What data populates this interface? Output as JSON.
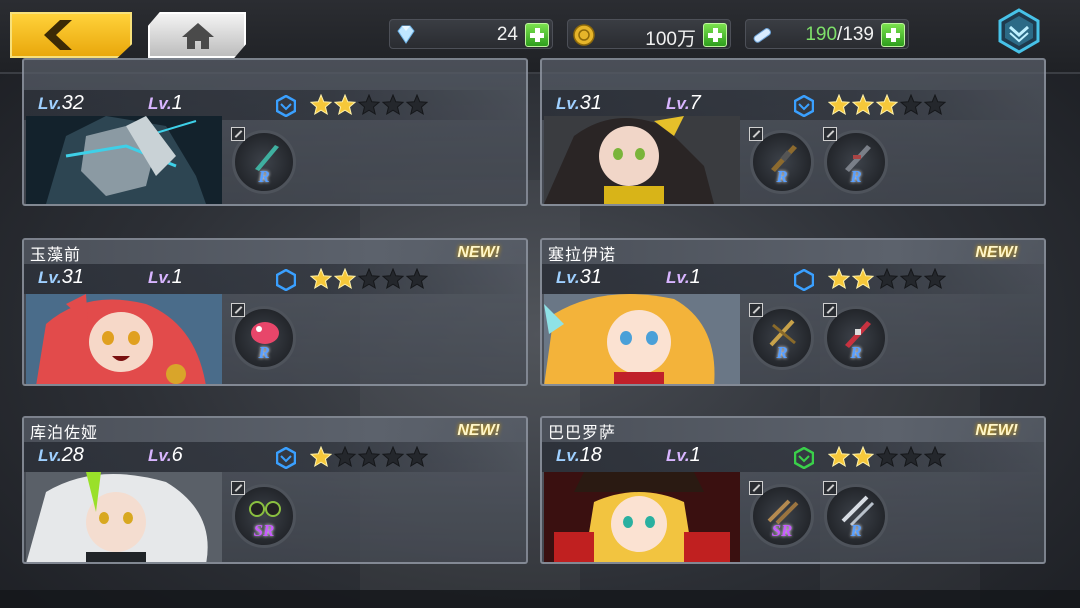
{
  "currencies": {
    "gems": {
      "value": "24",
      "icon": "diamond-icon"
    },
    "coins": {
      "value": "100万",
      "icon": "coin-icon"
    },
    "stamina": {
      "current": "190",
      "sep_max": "/139",
      "icon": "stamina-icon"
    }
  },
  "colors": {
    "accent_gold": "#f2c11e",
    "plus_green": "#3fb52a",
    "stamina_green": "#7ee06a"
  },
  "level_tags": {
    "lv1": "Lv.",
    "lv2": "Lv."
  },
  "cards": [
    {
      "name": "",
      "new": "",
      "lv": "32",
      "lv2": "1",
      "stars": 2,
      "grade": "blue-hex",
      "portrait": "dark-knight",
      "equips": [
        {
          "rank": "R",
          "weapon": "blade"
        }
      ]
    },
    {
      "name": "",
      "new": "",
      "lv": "31",
      "lv2": "7",
      "stars": 3,
      "grade": "blue-chevron",
      "portrait": "black-hair-girl",
      "equips": [
        {
          "rank": "R",
          "weapon": "rifle"
        },
        {
          "rank": "R",
          "weapon": "gun"
        }
      ]
    },
    {
      "name": "玉藻前",
      "new": "NEW!",
      "lv": "31",
      "lv2": "1",
      "stars": 2,
      "grade": "blue-hex",
      "portrait": "pink-fox-girl",
      "equips": [
        {
          "rank": "R",
          "weapon": "fish-bag"
        }
      ]
    },
    {
      "name": "塞拉伊诺",
      "new": "NEW!",
      "lv": "31",
      "lv2": "1",
      "stars": 2,
      "grade": "blue-hex",
      "portrait": "blonde-girl",
      "equips": [
        {
          "rank": "R",
          "weapon": "crossbow"
        },
        {
          "rank": "R",
          "weapon": "rifle"
        }
      ]
    },
    {
      "name": "库泊佐娅",
      "new": "NEW!",
      "lv": "28",
      "lv2": "6",
      "stars": 1,
      "grade": "blue-chevron",
      "portrait": "silver-hair-girl",
      "equips": [
        {
          "rank": "SR",
          "weapon": "glasses"
        }
      ]
    },
    {
      "name": "巴巴罗萨",
      "new": "NEW!",
      "lv": "18",
      "lv2": "1",
      "stars": 2,
      "grade": "green-chevron",
      "portrait": "pirate-girl",
      "equips": [
        {
          "rank": "SR",
          "weapon": "pistols"
        },
        {
          "rank": "R",
          "weapon": "swords"
        }
      ]
    }
  ]
}
